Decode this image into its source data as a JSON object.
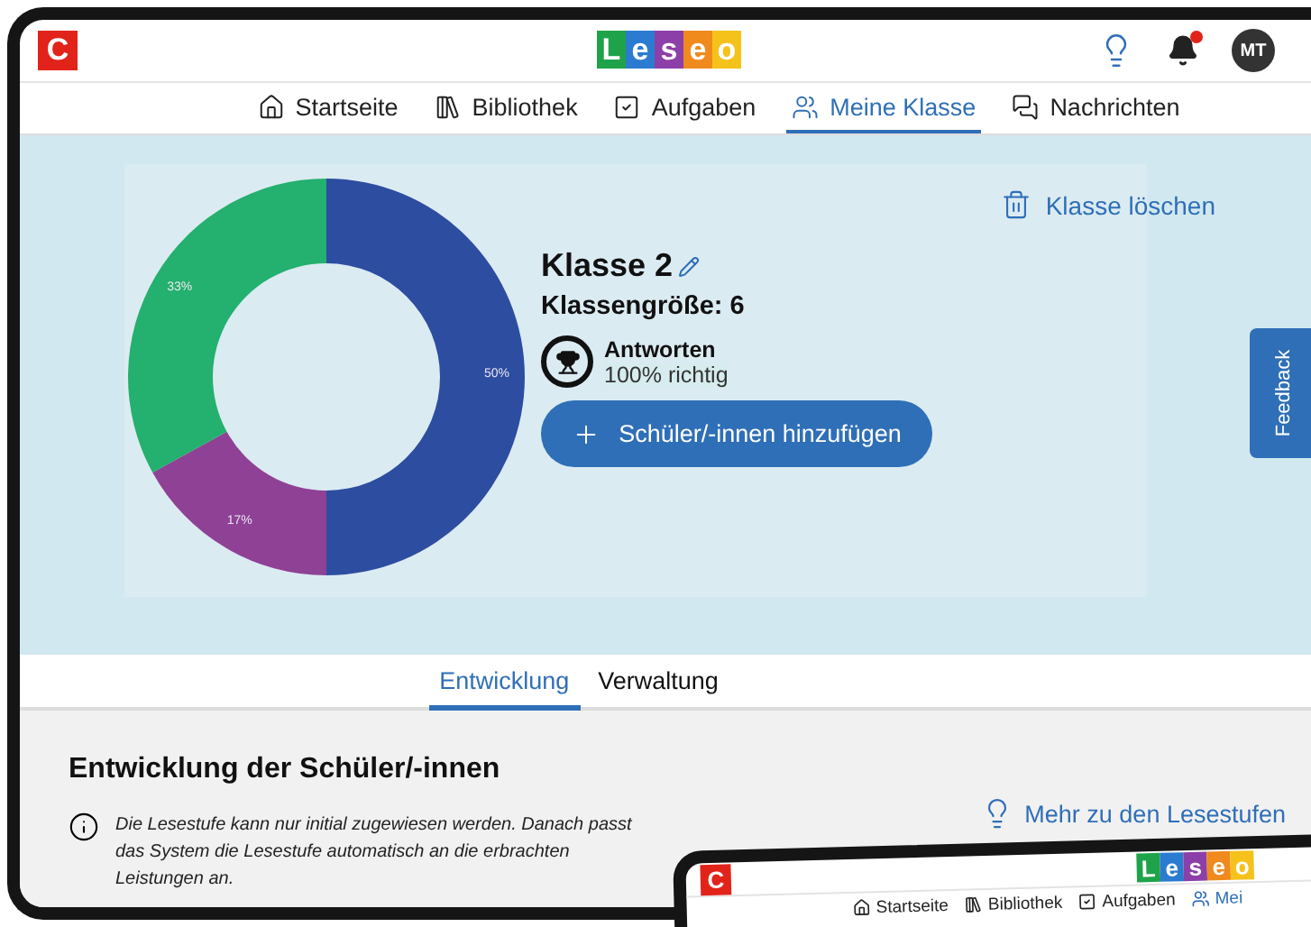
{
  "header": {
    "logo_letter": "C",
    "brand": [
      {
        "letter": "L",
        "color": "#1fa34a"
      },
      {
        "letter": "e",
        "color": "#2b7bd1"
      },
      {
        "letter": "s",
        "color": "#8c3fa8"
      },
      {
        "letter": "e",
        "color": "#f08a1c"
      },
      {
        "letter": "o",
        "color": "#f5c21b"
      }
    ],
    "notification": true,
    "avatar": "MT"
  },
  "nav": [
    {
      "label": "Startseite",
      "selected": false
    },
    {
      "label": "Bibliothek",
      "selected": false
    },
    {
      "label": "Aufgaben",
      "selected": false
    },
    {
      "label": "Meine Klasse",
      "selected": true
    },
    {
      "label": "Nachrichten",
      "selected": false
    }
  ],
  "class_panel": {
    "chart_data": {
      "type": "donut",
      "values": [
        50,
        17,
        33
      ],
      "data_labels": true,
      "value_labels": [
        "50%",
        "17%",
        "33%"
      ]
    },
    "delete_label": "Klasse löschen",
    "class_name": "Klasse 2",
    "class_size": "Klassengröße: 6",
    "answers_title": "Antworten",
    "answers_value": "100% richtig",
    "add_button": "Schüler/-innen hinzufügen"
  },
  "feedback": "Feedback",
  "tabs": [
    {
      "label": "Entwicklung",
      "selected": true
    },
    {
      "label": "Verwaltung",
      "selected": false
    }
  ],
  "development": {
    "title": "Entwicklung der Schüler/-innen",
    "info": "Die Lesestufe kann nur initial zugewiesen werden. Danach passt das System die Lesestufe automatisch an die erbrachten Leistungen an.",
    "link": "Mehr zu den Lesestufen"
  },
  "overlay_screen": {
    "logo_letter": "C",
    "brand": [
      {
        "letter": "L",
        "color": "#1fa34a"
      },
      {
        "letter": "e",
        "color": "#2b7bd1"
      },
      {
        "letter": "s",
        "color": "#8c3fa8"
      },
      {
        "letter": "e",
        "color": "#f08a1c"
      },
      {
        "letter": "o",
        "color": "#f5c21b"
      }
    ],
    "nav": [
      {
        "label": "Startseite",
        "selected": false
      },
      {
        "label": "Bibliothek",
        "selected": false
      },
      {
        "label": "Aufgaben",
        "selected": false
      },
      {
        "label": "Mei",
        "selected": true
      }
    ]
  }
}
